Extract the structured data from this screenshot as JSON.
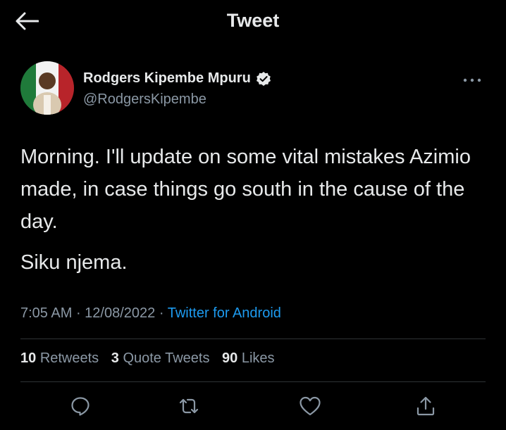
{
  "header": {
    "title": "Tweet",
    "back_icon": "arrow-left-icon"
  },
  "author": {
    "name": "Rodgers Kipembe Mpuru",
    "handle": "@RodgersKipembe",
    "verified": true
  },
  "tweet": {
    "paragraph1": "Morning. I'll update on some vital mistakes Azimio made, in case things go south in the cause of the day.",
    "paragraph2": "Siku njema."
  },
  "meta": {
    "time": "7:05 AM",
    "sep1": " · ",
    "date": "12/08/2022",
    "sep2": " · ",
    "source": "Twitter for Android"
  },
  "stats": {
    "retweets_count": "10",
    "retweets_label": "Retweets",
    "quotes_count": "3",
    "quotes_label": "Quote Tweets",
    "likes_count": "90",
    "likes_label": "Likes"
  },
  "colors": {
    "accent": "#1d9bf0",
    "background": "#000000",
    "text": "#e7e9ea",
    "muted": "#8b98a5"
  },
  "actions": [
    "reply-icon",
    "retweet-icon",
    "like-icon",
    "share-icon"
  ]
}
